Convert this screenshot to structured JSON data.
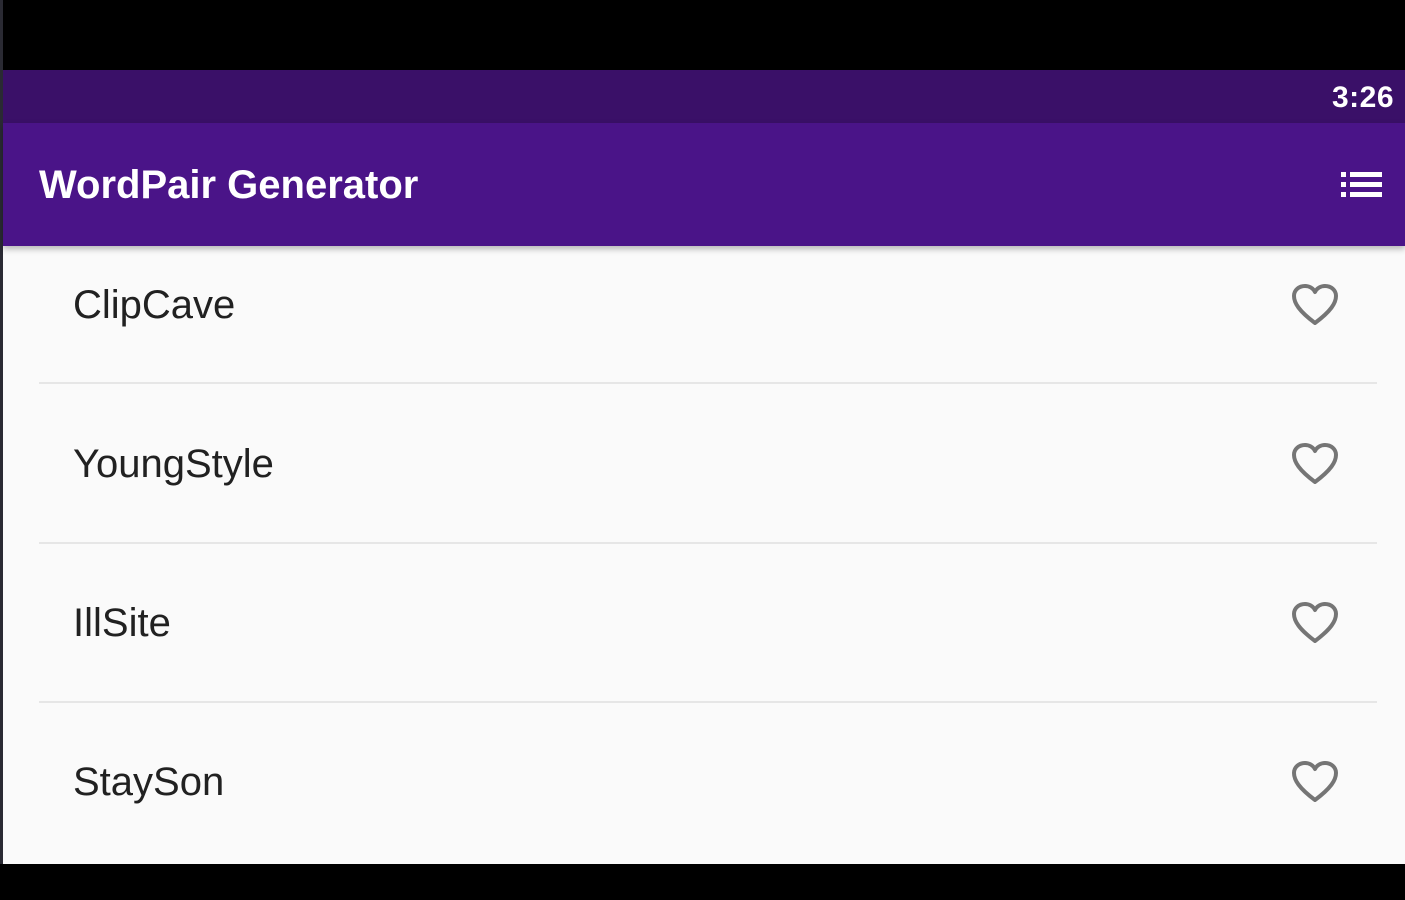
{
  "status_bar": {
    "time": "3:26"
  },
  "app_bar": {
    "title": "WordPair Generator",
    "action_icon": "list-icon"
  },
  "word_pairs": [
    {
      "label": "ClipCave",
      "icon": "heart-outline-icon",
      "favorited": false
    },
    {
      "label": "YoungStyle",
      "icon": "heart-outline-icon",
      "favorited": false
    },
    {
      "label": "IllSite",
      "icon": "heart-outline-icon",
      "favorited": false
    },
    {
      "label": "StaySon",
      "icon": "heart-outline-icon",
      "favorited": false
    }
  ],
  "colors": {
    "status_bar": "#3a1068",
    "app_bar": "#4a1488",
    "background": "#fafafa",
    "text": "#212121",
    "icon": "#757575",
    "divider": "#e6e6e6"
  }
}
